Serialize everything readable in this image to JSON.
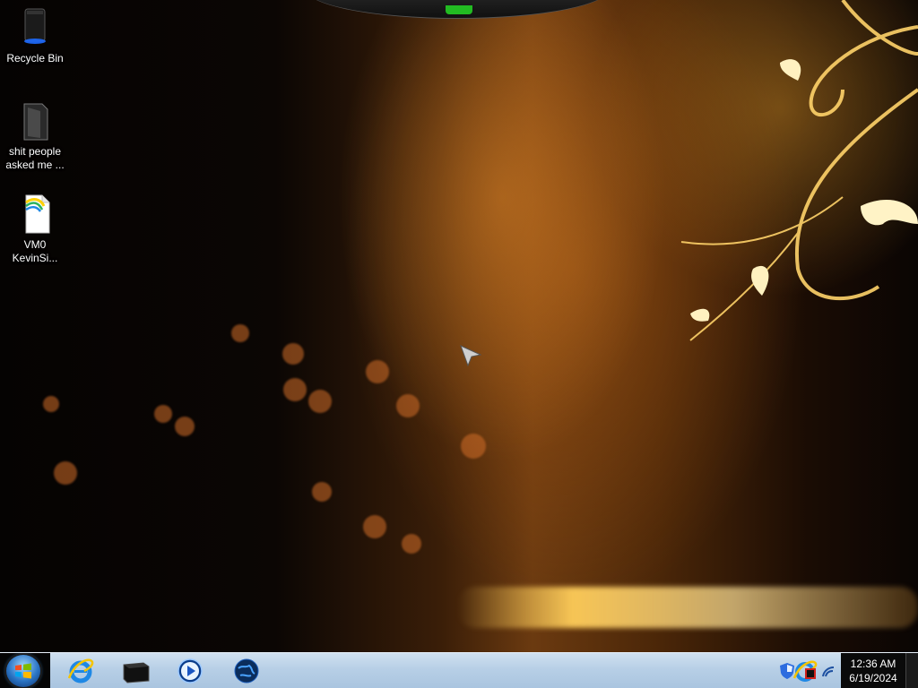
{
  "desktop": {
    "icons": [
      {
        "label_line1": "Recycle Bin",
        "label_line2": "",
        "icon": "recycle-bin-icon"
      },
      {
        "label_line1": "shit people",
        "label_line2": "asked me ...",
        "icon": "folder-icon"
      },
      {
        "label_line1": "VM0",
        "label_line2": "KevinSi...",
        "icon": "document-icon"
      }
    ]
  },
  "taskbar": {
    "start_icon": "windows-logo-icon",
    "pinned": [
      {
        "name": "internet-explorer",
        "icon": "internet-explorer-icon"
      },
      {
        "name": "file-manager",
        "icon": "black-device-icon"
      },
      {
        "name": "media-player",
        "icon": "media-player-icon"
      },
      {
        "name": "globe-app",
        "icon": "globe-icon"
      }
    ],
    "tray": [
      "security-shield-icon",
      "internet-explorer-tray-icon",
      "network-icon"
    ],
    "clock": {
      "time": "12:36 AM",
      "date": "6/19/2024"
    }
  }
}
